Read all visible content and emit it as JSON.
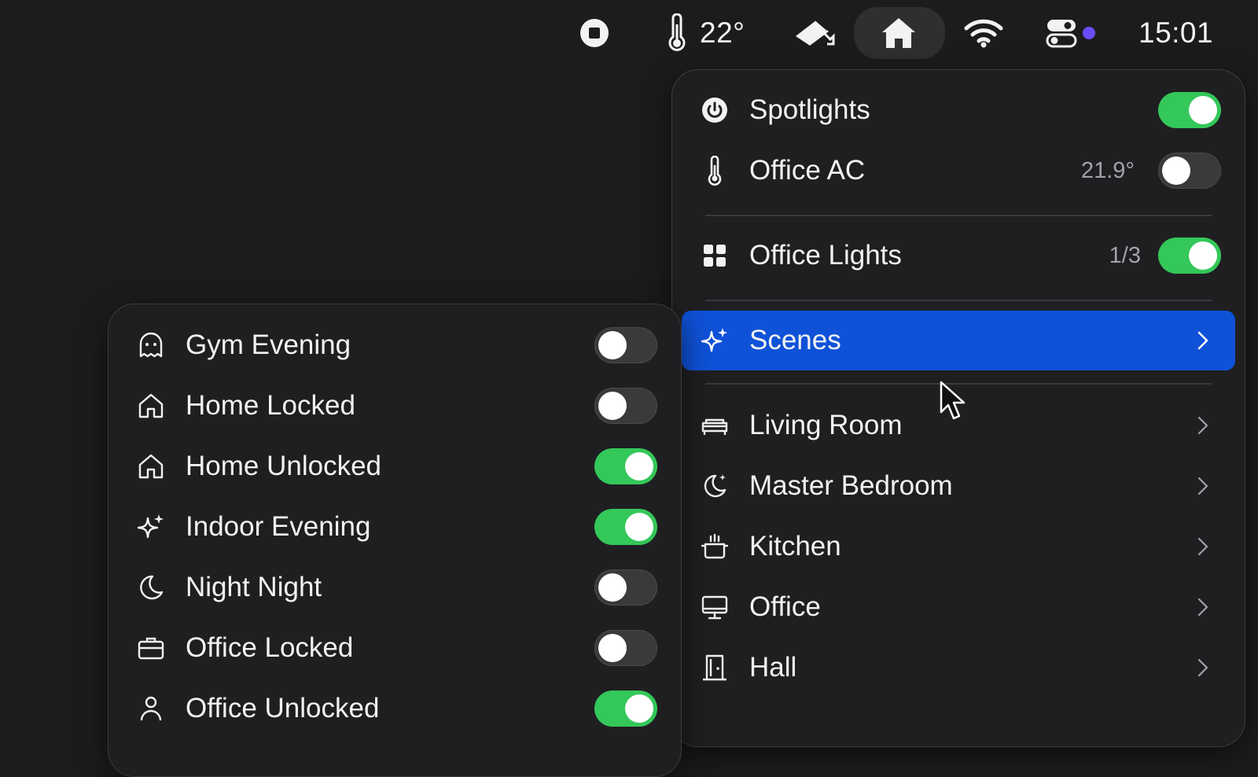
{
  "menubar": {
    "temperature": "22°",
    "time": "15:01",
    "icons": [
      "stop-icon",
      "thermometer-icon",
      "camera-icon",
      "home-icon",
      "wifi-icon",
      "control-center-icon",
      "status-dot-icon"
    ],
    "status_dot_color": "#6a4cff"
  },
  "main_menu": {
    "items": [
      {
        "label": "Spotlights",
        "icon": "power-icon",
        "toggle": true
      },
      {
        "label": "Office AC",
        "icon": "thermometer-icon",
        "value": "21.9°",
        "toggle": false
      },
      {
        "label": "Office Lights",
        "icon": "grid-icon",
        "value": "1/3",
        "toggle": true
      },
      {
        "label": "Scenes",
        "icon": "sparkles-icon",
        "selected": true,
        "submenu": true
      },
      {
        "label": "Living Room",
        "icon": "sofa-icon",
        "submenu": true
      },
      {
        "label": "Master Bedroom",
        "icon": "moon-star-icon",
        "submenu": true
      },
      {
        "label": "Kitchen",
        "icon": "pot-icon",
        "submenu": true
      },
      {
        "label": "Office",
        "icon": "monitor-icon",
        "submenu": true
      },
      {
        "label": "Hall",
        "icon": "door-icon",
        "submenu": true
      }
    ]
  },
  "scenes_menu": {
    "items": [
      {
        "label": "Gym Evening",
        "icon": "ghost-icon",
        "toggle": false
      },
      {
        "label": "Home Locked",
        "icon": "house-icon",
        "toggle": false
      },
      {
        "label": "Home Unlocked",
        "icon": "house-icon",
        "toggle": true
      },
      {
        "label": "Indoor Evening",
        "icon": "sparkles-icon",
        "toggle": true
      },
      {
        "label": "Night Night",
        "icon": "moon-icon",
        "toggle": false
      },
      {
        "label": "Office Locked",
        "icon": "briefcase-icon",
        "toggle": false
      },
      {
        "label": "Office Unlocked",
        "icon": "person-icon",
        "toggle": true
      }
    ]
  },
  "colors": {
    "accent": "#0f52d8",
    "toggle_on": "#34c759",
    "toggle_off": "#3a3a3c",
    "background": "#1c1c1e"
  }
}
